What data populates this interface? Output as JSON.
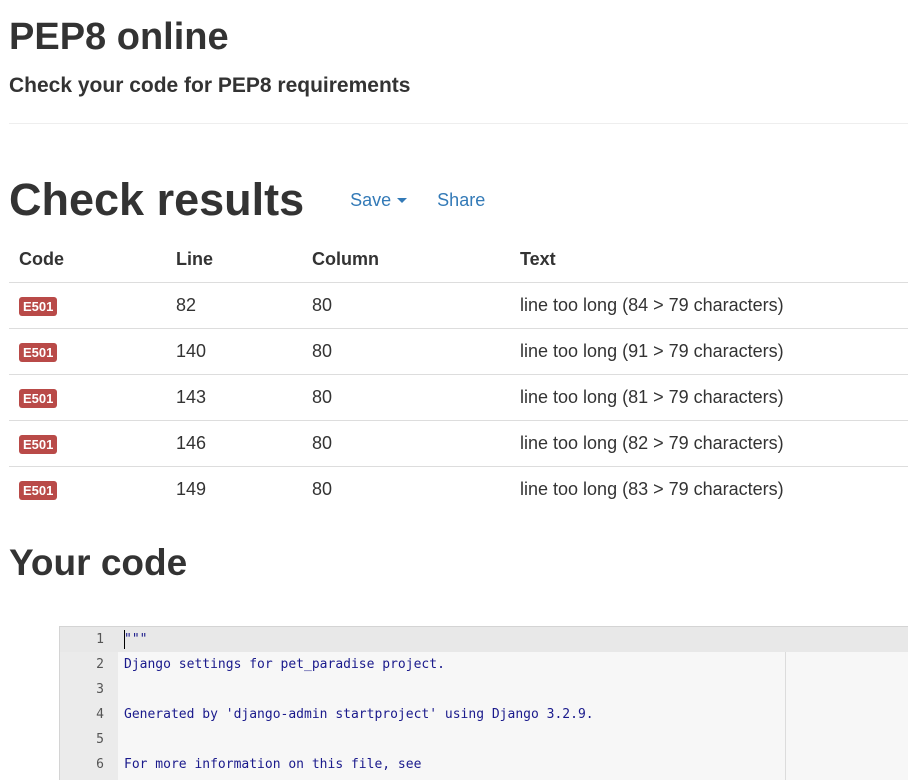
{
  "header": {
    "title": "PEP8 online",
    "subtitle": "Check your code for PEP8 requirements"
  },
  "results": {
    "title": "Check results",
    "save_label": "Save",
    "share_label": "Share",
    "columns": [
      "Code",
      "Line",
      "Column",
      "Text"
    ],
    "rows": [
      {
        "code": "E501",
        "line": "82",
        "column": "80",
        "text": "line too long (84 > 79 characters)"
      },
      {
        "code": "E501",
        "line": "140",
        "column": "80",
        "text": "line too long (91 > 79 characters)"
      },
      {
        "code": "E501",
        "line": "143",
        "column": "80",
        "text": "line too long (81 > 79 characters)"
      },
      {
        "code": "E501",
        "line": "146",
        "column": "80",
        "text": "line too long (82 > 79 characters)"
      },
      {
        "code": "E501",
        "line": "149",
        "column": "80",
        "text": "line too long (83 > 79 characters)"
      }
    ],
    "badge_color": "#b94a48"
  },
  "code": {
    "title": "Your code",
    "lines": [
      {
        "num": "1",
        "text": "\"\"\""
      },
      {
        "num": "2",
        "text": "Django settings for pet_paradise project."
      },
      {
        "num": "3",
        "text": ""
      },
      {
        "num": "4",
        "text": "Generated by 'django-admin startproject' using Django 3.2.9."
      },
      {
        "num": "5",
        "text": ""
      },
      {
        "num": "6",
        "text": "For more information on this file, see"
      }
    ]
  },
  "colors": {
    "link": "#337ab7",
    "code_text": "#1a1a8c"
  }
}
